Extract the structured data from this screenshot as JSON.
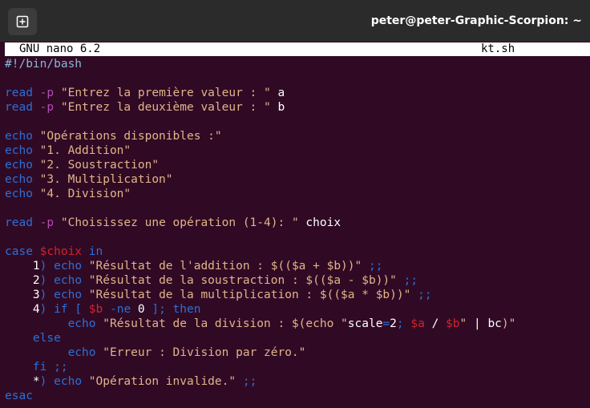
{
  "window": {
    "title": "peter@peter-Graphic-Scorpion: ~",
    "new_tab_icon": "new-tab-icon"
  },
  "nano": {
    "version": "GNU nano 6.2",
    "filename": "kt.sh"
  },
  "code": [
    [
      [
        "sh",
        "#!/bin/bash"
      ]
    ],
    [],
    [
      [
        "kw",
        "read "
      ],
      [
        "opt",
        "-p "
      ],
      [
        "str",
        "\"Entrez la première valeur : \""
      ],
      [
        "pl",
        " a"
      ]
    ],
    [
      [
        "kw",
        "read "
      ],
      [
        "opt",
        "-p "
      ],
      [
        "str",
        "\"Entrez la deuxième valeur : \""
      ],
      [
        "pl",
        " b"
      ]
    ],
    [],
    [
      [
        "kw",
        "echo "
      ],
      [
        "str",
        "\"Opérations disponibles :\""
      ]
    ],
    [
      [
        "kw",
        "echo "
      ],
      [
        "str",
        "\"1. Addition\""
      ]
    ],
    [
      [
        "kw",
        "echo "
      ],
      [
        "str",
        "\"2. Soustraction\""
      ]
    ],
    [
      [
        "kw",
        "echo "
      ],
      [
        "str",
        "\"3. Multiplication\""
      ]
    ],
    [
      [
        "kw",
        "echo "
      ],
      [
        "str",
        "\"4. Division\""
      ]
    ],
    [],
    [
      [
        "kw",
        "read "
      ],
      [
        "opt",
        "-p "
      ],
      [
        "str",
        "\"Choisissez une opération (1-4): \""
      ],
      [
        "pl",
        " choix"
      ]
    ],
    [],
    [
      [
        "kw",
        "case "
      ],
      [
        "var",
        "$choix"
      ],
      [
        "kw",
        " in"
      ]
    ],
    [
      [
        "pl",
        "    1"
      ],
      [
        "sep",
        ") "
      ],
      [
        "kw",
        "echo "
      ],
      [
        "str",
        "\"Résultat de l'addition : $(($a + $b))\""
      ],
      [
        "sep",
        " ;;"
      ]
    ],
    [
      [
        "pl",
        "    2"
      ],
      [
        "sep",
        ") "
      ],
      [
        "kw",
        "echo "
      ],
      [
        "str",
        "\"Résultat de la soustraction : $(($a - $b))\""
      ],
      [
        "sep",
        " ;;"
      ]
    ],
    [
      [
        "pl",
        "    3"
      ],
      [
        "sep",
        ") "
      ],
      [
        "kw",
        "echo "
      ],
      [
        "str",
        "\"Résultat de la multiplication : $(($a * $b))\""
      ],
      [
        "sep",
        " ;;"
      ]
    ],
    [
      [
        "pl",
        "    4"
      ],
      [
        "sep",
        ") "
      ],
      [
        "kw",
        "if [ "
      ],
      [
        "var",
        "$b"
      ],
      [
        "kw",
        " -ne "
      ],
      [
        "num",
        "0"
      ],
      [
        "kw",
        " ]; then"
      ]
    ],
    [
      [
        "pl",
        "         "
      ],
      [
        "kw",
        "echo "
      ],
      [
        "str",
        "\"Résultat de la division : $(echo \""
      ],
      [
        "pl",
        "scale"
      ],
      [
        "sep",
        "="
      ],
      [
        "pl",
        "2"
      ],
      [
        "sep",
        "; "
      ],
      [
        "var",
        "$a"
      ],
      [
        "pl",
        " / "
      ],
      [
        "var",
        "$b"
      ],
      [
        "str",
        "\""
      ],
      [
        "pl",
        " | "
      ],
      [
        "pl",
        "bc"
      ],
      [
        "str",
        ")\""
      ]
    ],
    [
      [
        "kw",
        "    else"
      ]
    ],
    [
      [
        "pl",
        "         "
      ],
      [
        "kw",
        "echo "
      ],
      [
        "str",
        "\"Erreur : Division par zéro.\""
      ]
    ],
    [
      [
        "kw",
        "    fi ;;"
      ]
    ],
    [
      [
        "pl",
        "    *"
      ],
      [
        "sep",
        ") "
      ],
      [
        "kw",
        "echo "
      ],
      [
        "str",
        "\"Opération invalide.\""
      ],
      [
        "sep",
        " ;;"
      ]
    ],
    [
      [
        "kw",
        "esac"
      ]
    ]
  ]
}
